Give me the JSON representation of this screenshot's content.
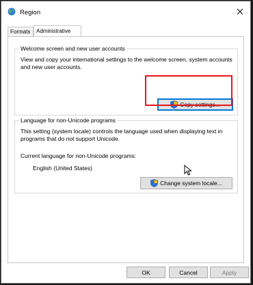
{
  "window": {
    "title": "Region",
    "close_icon": "close-icon",
    "app_icon": "globe-icon"
  },
  "tabs": [
    {
      "label": "Formats",
      "active": false
    },
    {
      "label": "Administrative",
      "active": true
    }
  ],
  "welcome": {
    "legend": "Welcome screen and new user accounts",
    "description": "View and copy your international settings to the welcome screen, system accounts and new user accounts.",
    "button_label": "Copy settings...",
    "button_icon": "uac-shield-icon"
  },
  "unicode": {
    "legend": "Language for non-Unicode programs",
    "description": "This setting (system locale) controls the language used when displaying text in programs that do not support Unicode.",
    "current_label": "Current language for non-Unicode programs:",
    "current_value": "English (United States)",
    "button_label": "Change system locale...",
    "button_icon": "uac-shield-icon"
  },
  "footer": {
    "ok_label": "OK",
    "cancel_label": "Cancel",
    "apply_label": "Apply"
  },
  "colors": {
    "highlight": "#e8141c",
    "focus": "#0078d7"
  }
}
